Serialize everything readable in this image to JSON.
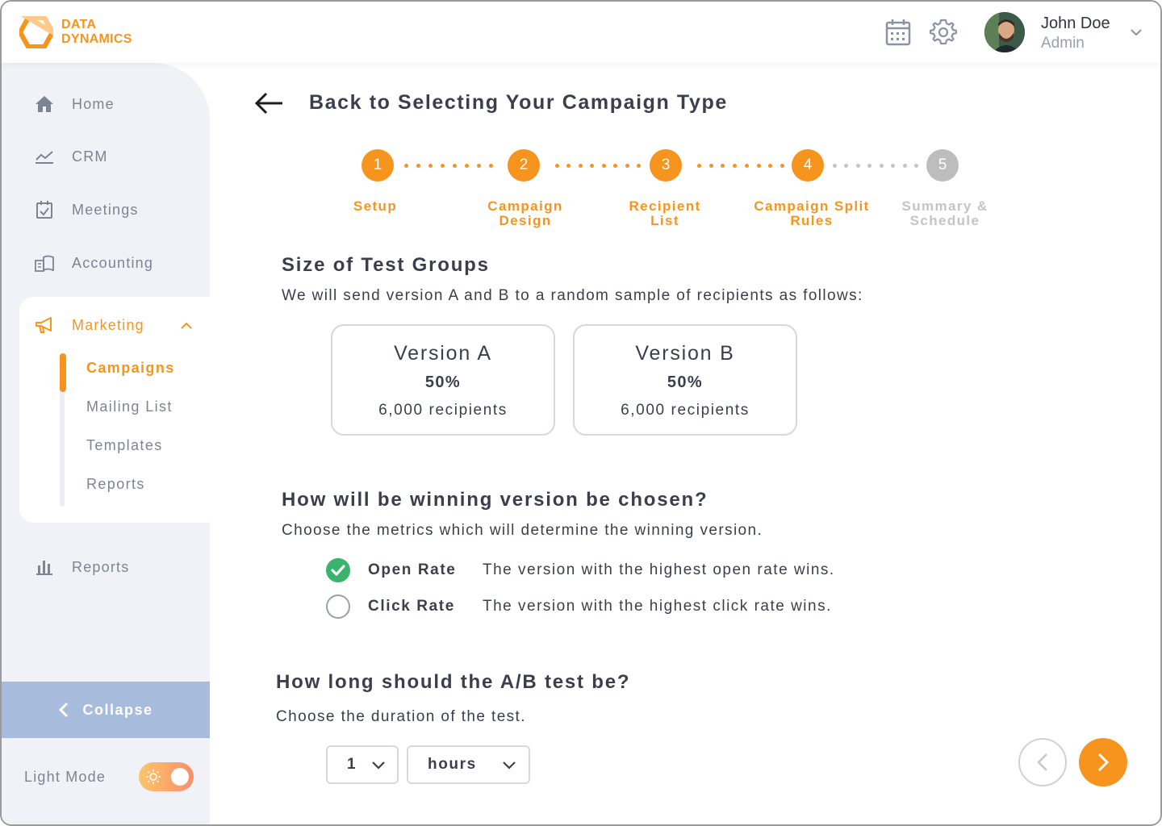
{
  "brand": {
    "line1": "DATA",
    "line2": "DYNAMICS",
    "accent": "#f7941d"
  },
  "header": {
    "icons": [
      "calendar-icon",
      "gear-icon"
    ],
    "user": {
      "name": "John Doe",
      "role": "Admin"
    }
  },
  "sidebar": {
    "items": [
      {
        "label": "Home",
        "icon": "home-icon"
      },
      {
        "label": "CRM",
        "icon": "chart-line-icon"
      },
      {
        "label": "Meetings",
        "icon": "calendar-check-icon"
      },
      {
        "label": "Accounting",
        "icon": "ledger-icon"
      },
      {
        "label": "Marketing",
        "icon": "megaphone-icon"
      },
      {
        "label": "Reports",
        "icon": "bar-chart-icon"
      }
    ],
    "marketing_sub": [
      {
        "label": "Campaigns",
        "active": true
      },
      {
        "label": "Mailing List"
      },
      {
        "label": "Templates"
      },
      {
        "label": "Reports"
      }
    ],
    "collapse_label": "Collapse",
    "light_mode_label": "Light Mode"
  },
  "main": {
    "back_label": "Back to Selecting Your Campaign Type",
    "steps": [
      {
        "num": "1",
        "line1": "Setup",
        "line2": "",
        "active": true
      },
      {
        "num": "2",
        "line1": "Campaign",
        "line2": "Design",
        "active": true
      },
      {
        "num": "3",
        "line1": "Recipient",
        "line2": "List",
        "active": true
      },
      {
        "num": "4",
        "line1": "Campaign Split",
        "line2": "Rules",
        "active": true
      },
      {
        "num": "5",
        "line1": "Summary &",
        "line2": "Schedule",
        "active": false
      }
    ],
    "test_groups": {
      "title": "Size of Test Groups",
      "desc": "We will send version A and B to a random sample of recipients as follows:",
      "versions": [
        {
          "name": "Version A",
          "percent": "50%",
          "recipients": "6,000 recipients"
        },
        {
          "name": "Version B",
          "percent": "50%",
          "recipients": "6,000 recipients"
        }
      ]
    },
    "winning": {
      "title": "How will be winning version be chosen?",
      "desc": "Choose the metrics which will determine the winning version.",
      "metrics": [
        {
          "name": "Open Rate",
          "desc": "The version with the highest open rate wins.",
          "selected": true
        },
        {
          "name": "Click Rate",
          "desc": "The version with the highest click rate wins.",
          "selected": false
        }
      ]
    },
    "duration": {
      "title": "How long should the A/B test be?",
      "desc": "Choose the duration of the test.",
      "amount": "1",
      "unit": "hours"
    }
  }
}
